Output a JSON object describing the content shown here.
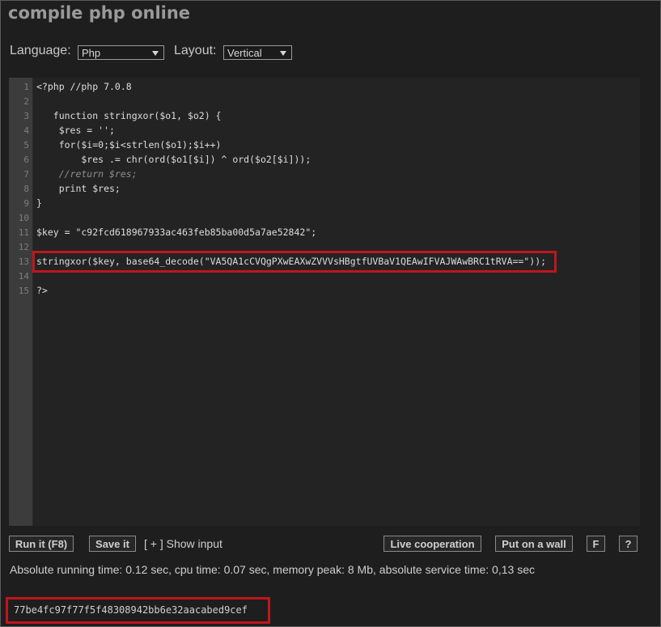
{
  "header": {
    "title": "compile php online"
  },
  "options": {
    "language_label": "Language:",
    "language_value": "Php",
    "layout_label": "Layout:",
    "layout_value": "Vertical"
  },
  "editor": {
    "line_numbers": [
      "1",
      "2",
      "3",
      "4",
      "5",
      "6",
      "7",
      "8",
      "9",
      "10",
      "11",
      "12",
      "13",
      "14",
      "15"
    ],
    "lines": [
      "<?php //php 7.0.8",
      "",
      "   function stringxor($o1, $o2) {",
      "    $res = '';",
      "    for($i=0;$i<strlen($o1);$i++)",
      "        $res .= chr(ord($o1[$i]) ^ ord($o2[$i]));",
      "    //return $res;",
      "    print $res;",
      "}",
      "",
      "$key = \"c92fcd618967933ac463feb85ba00d5a7ae52842\";",
      "",
      "stringxor($key, base64_decode(\"VA5QA1cCVQgPXwEAXwZVVVsHBgtfUVBaV1QEAwIFVAJWAwBRC1tRVA==\"));",
      "",
      "?>"
    ]
  },
  "toolbar": {
    "run_label": "Run it (F8)",
    "save_label": "Save it",
    "show_input_label": "[ + ] Show input",
    "live_label": "Live cooperation",
    "wall_label": "Put on a wall",
    "f_label": "F",
    "help_label": "?"
  },
  "stats": {
    "text": "Absolute running time: 0.12 sec, cpu time: 0.07 sec, memory peak: 8 Mb, absolute service time: 0,13 sec"
  },
  "output": {
    "text": "77be4fc97f77f5f48308942bb6e32aacabed9cef"
  },
  "colors": {
    "highlight": "#c0161c",
    "background": "#1e1e1e",
    "gutter": "#3c3c3c"
  }
}
